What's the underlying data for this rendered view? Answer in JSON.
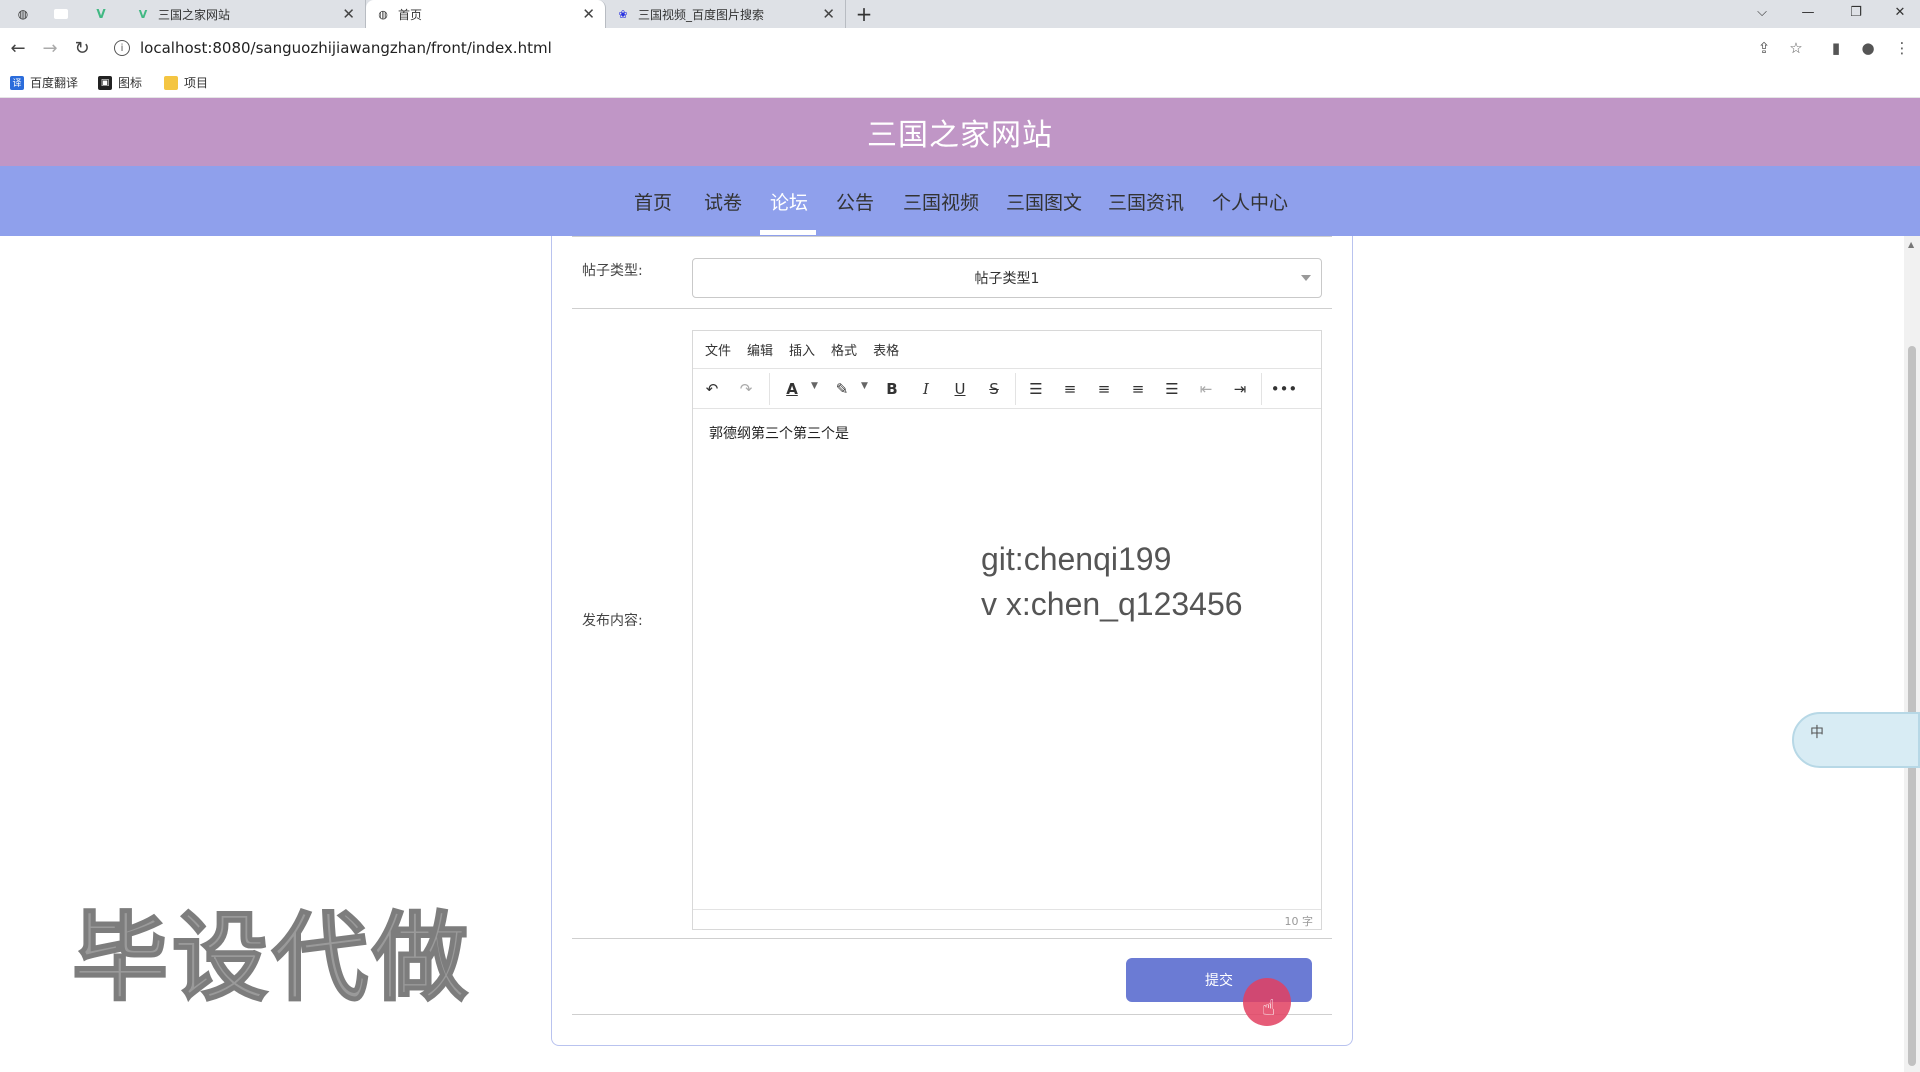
{
  "browser": {
    "tabs": [
      {
        "title": "三国之家网站"
      },
      {
        "title": "首页"
      },
      {
        "title": "三国视频_百度图片搜索"
      }
    ],
    "url": "localhost:8080/sanguozhijiawangzhan/front/index.html",
    "bookmarks": [
      "百度翻译",
      "图标",
      "项目"
    ]
  },
  "site": {
    "title": "三国之家网站",
    "nav": [
      "首页",
      "试卷",
      "论坛",
      "公告",
      "三国视频",
      "三国图文",
      "三国资讯",
      "个人中心"
    ],
    "active_nav": "论坛"
  },
  "form": {
    "type_label": "帖子类型:",
    "type_value": "帖子类型1",
    "content_label": "发布内容:",
    "editor_menu": [
      "文件",
      "编辑",
      "插入",
      "格式",
      "表格"
    ],
    "content": "郭德纲第三个第三个是",
    "word_count": "10 字",
    "submit_label": "提交"
  },
  "overlay": {
    "line1": "git:chenqi199",
    "line2": "v x:chen_q123456",
    "watermark": "毕设代做",
    "ime": "中"
  },
  "colors": {
    "header": "#c096c6",
    "nav": "#8fa0ec",
    "submit": "#6b7bd4"
  }
}
